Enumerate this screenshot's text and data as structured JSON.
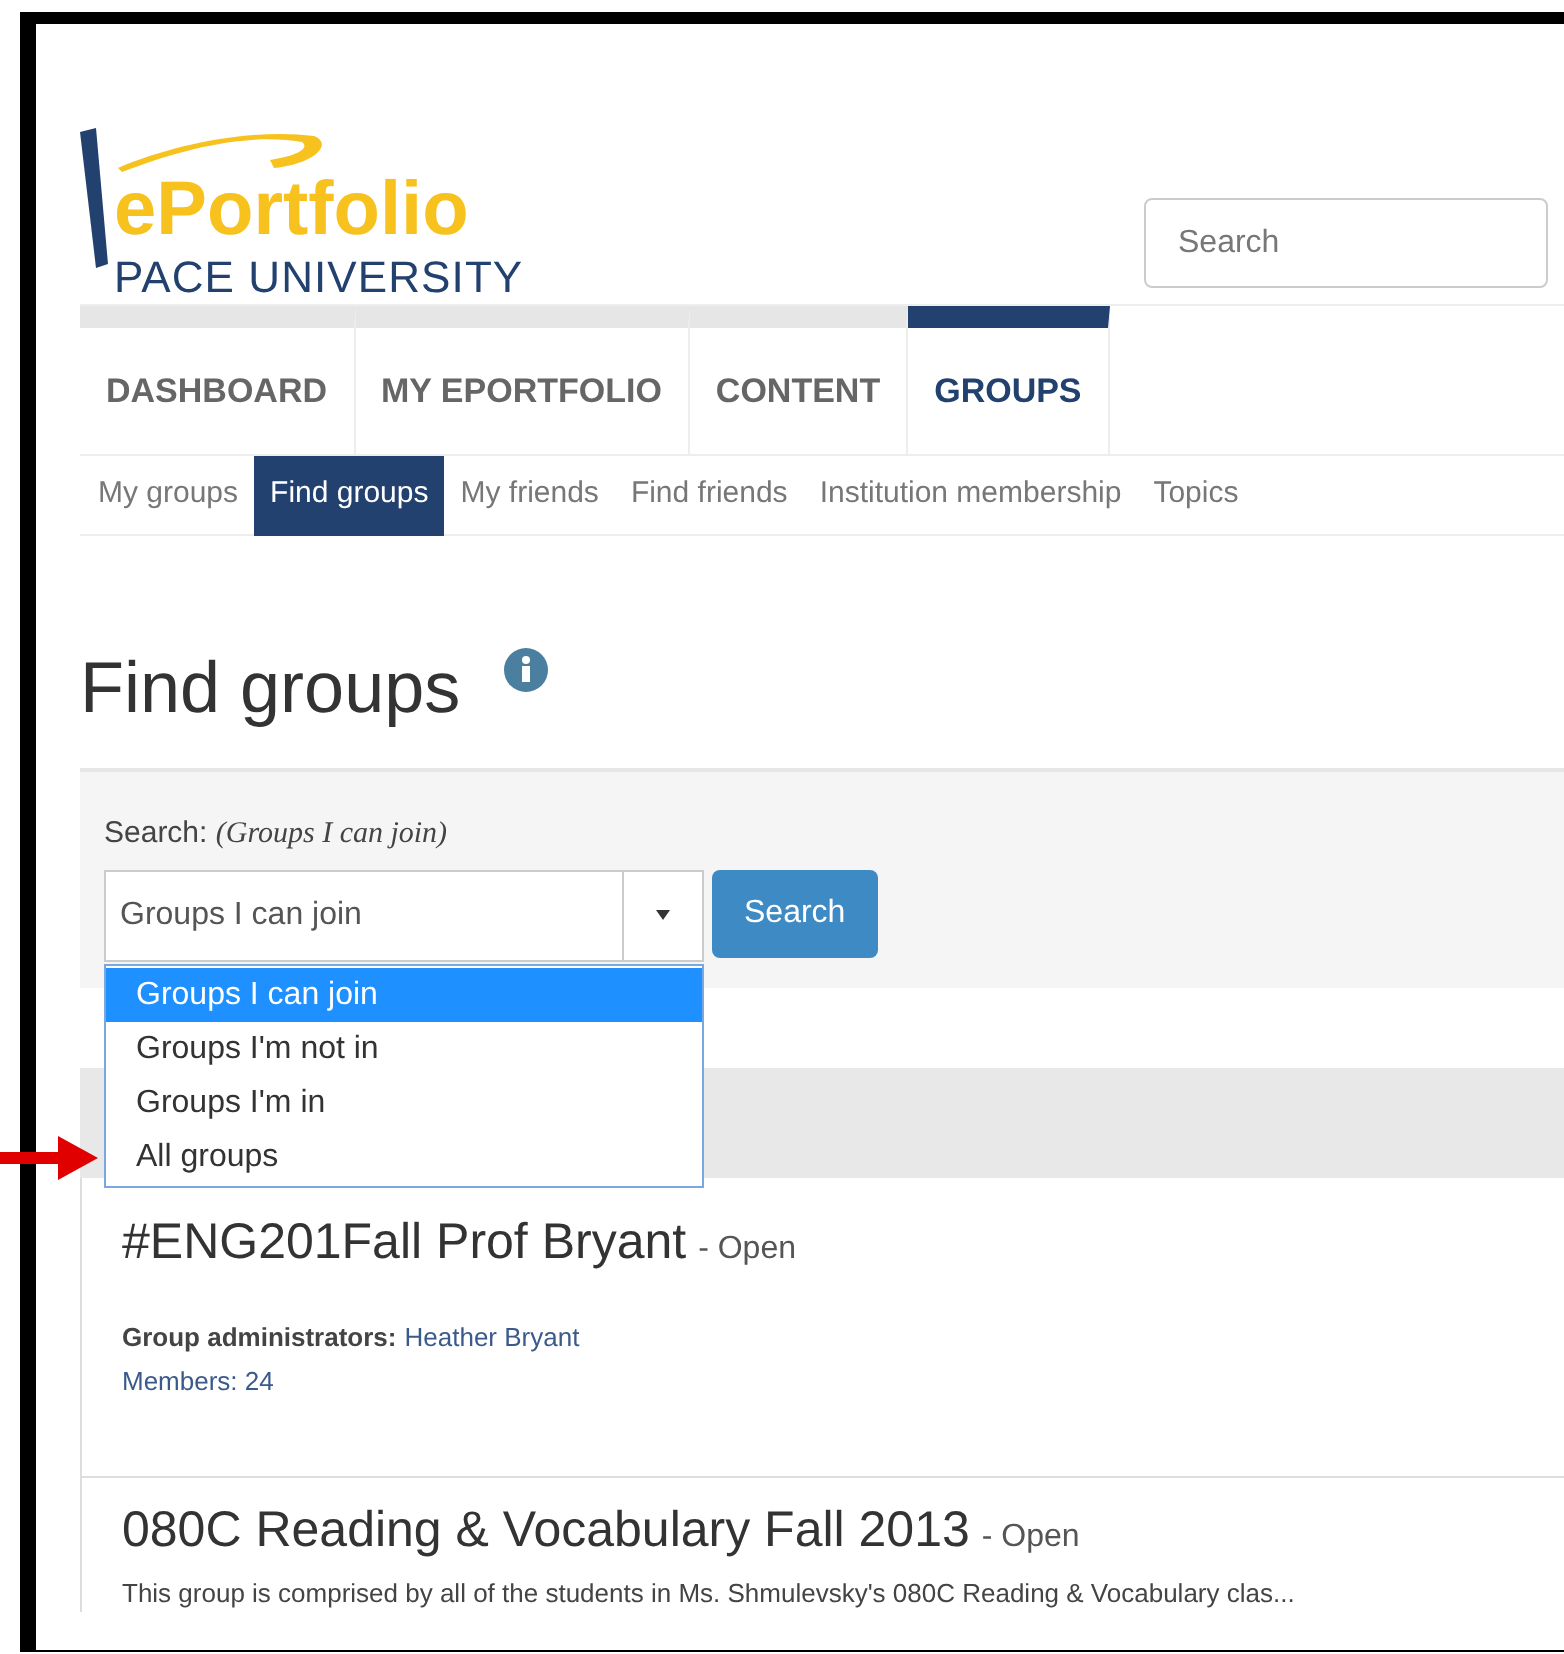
{
  "logo": {
    "title": "ePortfolio",
    "subtitle": "PACE UNIVERSITY"
  },
  "site_search": {
    "placeholder": "Search"
  },
  "main_nav": [
    {
      "label": "DASHBOARD",
      "selected": false
    },
    {
      "label": "MY EPORTFOLIO",
      "selected": false
    },
    {
      "label": "CONTENT",
      "selected": false
    },
    {
      "label": "GROUPS",
      "selected": true
    }
  ],
  "sub_nav": [
    {
      "label": "My groups",
      "selected": false
    },
    {
      "label": "Find groups",
      "selected": true
    },
    {
      "label": "My friends",
      "selected": false
    },
    {
      "label": "Find friends",
      "selected": false
    },
    {
      "label": "Institution membership",
      "selected": false
    },
    {
      "label": "Topics",
      "selected": false
    }
  ],
  "page_title": "Find groups",
  "search_form": {
    "label": "Search:",
    "hint": "(Groups I can join)",
    "value": "Groups I can join",
    "button": "Search",
    "options": [
      {
        "label": "Groups I can join",
        "selected": true
      },
      {
        "label": "Groups I'm not in",
        "selected": false
      },
      {
        "label": "Groups I'm in",
        "selected": false
      },
      {
        "label": "All groups",
        "selected": false,
        "pointed": true
      }
    ]
  },
  "groups": [
    {
      "name": "#ENG201Fall Prof Bryant",
      "status": "- Open",
      "admin_label": "Group administrators:",
      "admin": "Heather Bryant",
      "members": "Members: 24"
    },
    {
      "name": "080C Reading & Vocabulary Fall 2013",
      "status": "- Open",
      "description": "This group is comprised by all of the students in Ms. Shmulevsky's 080C Reading & Vocabulary clas..."
    }
  ]
}
